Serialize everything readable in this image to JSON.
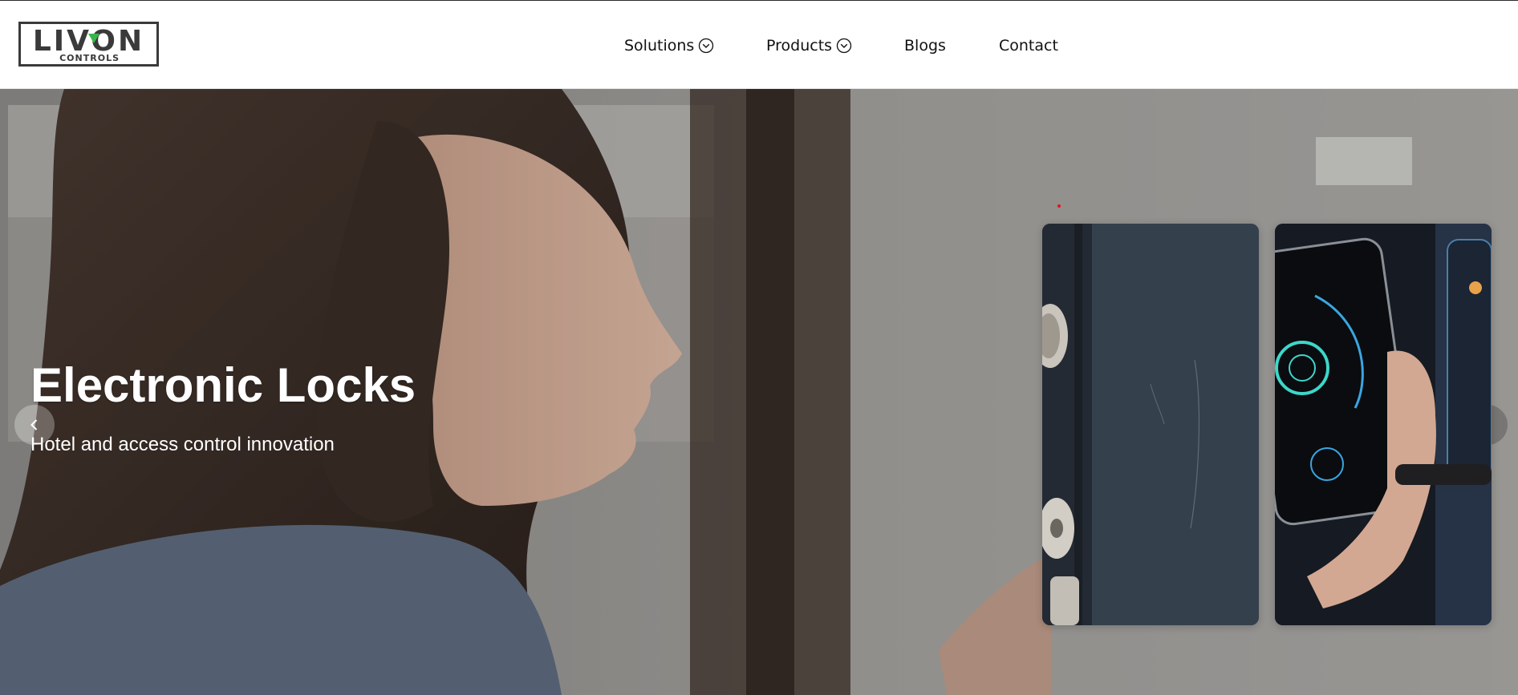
{
  "brand": {
    "name": "LIVON",
    "tagline": "CONTROLS",
    "accent_color": "#39b54a"
  },
  "nav": {
    "items": [
      {
        "label": "Solutions",
        "has_dropdown": true,
        "icon": "chevron-down-circle-icon"
      },
      {
        "label": "Products",
        "has_dropdown": true,
        "icon": "chevron-down-circle-icon"
      },
      {
        "label": "Blogs",
        "has_dropdown": false
      },
      {
        "label": "Contact",
        "has_dropdown": false
      }
    ]
  },
  "hero": {
    "title": "Electronic Locks",
    "subtitle": "Hotel and access control innovation",
    "prev_icon": "chevron-left-icon",
    "next_icon": "chevron-right-icon",
    "indicator_color": "#e0141e",
    "cards": [
      {
        "image": "door-lock-closeup"
      },
      {
        "image": "phone-smart-lock-app"
      }
    ]
  }
}
